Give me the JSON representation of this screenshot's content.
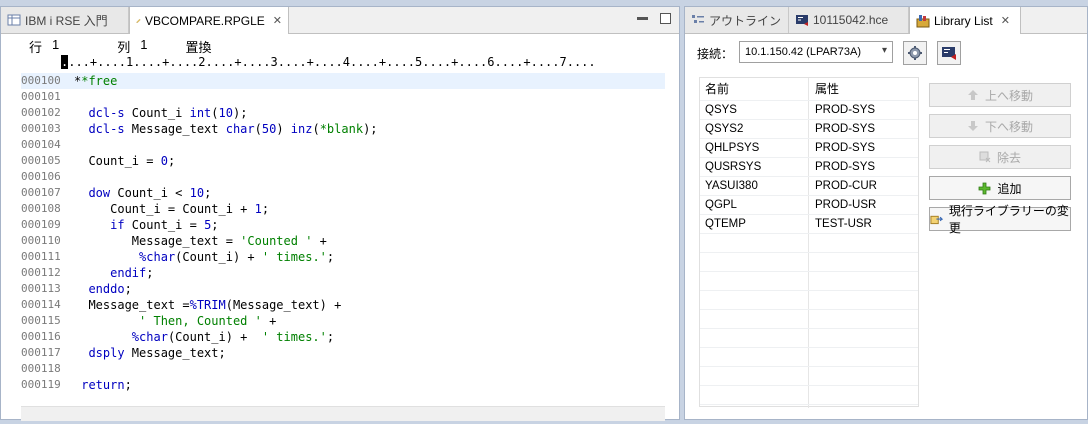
{
  "editor": {
    "tabs": [
      {
        "label": "IBM i RSE 入門"
      },
      {
        "label": "VBCOMPARE.RPGLE"
      }
    ],
    "status": {
      "row_label": "行",
      "row": "1",
      "col_label": "列",
      "col": "1",
      "mode": "置換"
    },
    "ruler": "....+....1....+....2....+....3....+....4....+....5....+....6....+....7....",
    "lines": [
      {
        "num": "000100",
        "text": "**free"
      },
      {
        "num": "000101",
        "text": ""
      },
      {
        "num": "000102",
        "text": "  dcl-s Count_i int(10);"
      },
      {
        "num": "000103",
        "text": "  dcl-s Message_text char(50) inz(*blank);"
      },
      {
        "num": "000104",
        "text": ""
      },
      {
        "num": "000105",
        "text": "  Count_i = 0;"
      },
      {
        "num": "000106",
        "text": ""
      },
      {
        "num": "000107",
        "text": "  dow Count_i < 10;"
      },
      {
        "num": "000108",
        "text": "     Count_i = Count_i + 1;"
      },
      {
        "num": "000109",
        "text": "     if Count_i = 5;"
      },
      {
        "num": "000110",
        "text": "        Message_text = 'Counted ' +"
      },
      {
        "num": "000111",
        "text": "         %char(Count_i) + ' times.';"
      },
      {
        "num": "000112",
        "text": "     endif;"
      },
      {
        "num": "000113",
        "text": "  enddo;"
      },
      {
        "num": "000114",
        "text": "  Message_text =%TRIM(Message_text) +"
      },
      {
        "num": "000115",
        "text": "         ' Then, Counted ' +"
      },
      {
        "num": "000116",
        "text": "        %char(Count_i) +  ' times.';"
      },
      {
        "num": "000117",
        "text": "  dsply Message_text;"
      },
      {
        "num": "000118",
        "text": ""
      },
      {
        "num": "000119",
        "text": " return;"
      }
    ]
  },
  "right_panel": {
    "tabs": [
      {
        "label": "アウトライン"
      },
      {
        "label": "10115042.hce"
      },
      {
        "label": "Library List"
      }
    ],
    "connection_label": "接続：",
    "connection_value": "10.1.150.42 (LPAR73A)",
    "columns": [
      "名前",
      "属性"
    ],
    "rows": [
      {
        "name": "QSYS",
        "attr": "PROD-SYS"
      },
      {
        "name": "QSYS2",
        "attr": "PROD-SYS"
      },
      {
        "name": "QHLPSYS",
        "attr": "PROD-SYS"
      },
      {
        "name": "QUSRSYS",
        "attr": "PROD-SYS"
      },
      {
        "name": "YASUI380",
        "attr": "PROD-CUR"
      },
      {
        "name": "QGPL",
        "attr": "PROD-USR"
      },
      {
        "name": "QTEMP",
        "attr": "TEST-USR"
      }
    ],
    "buttons": {
      "move_up": "上へ移動",
      "move_down": "下へ移動",
      "remove": "除去",
      "add": "追加",
      "change_current": "現行ライブラリーの変更"
    }
  }
}
